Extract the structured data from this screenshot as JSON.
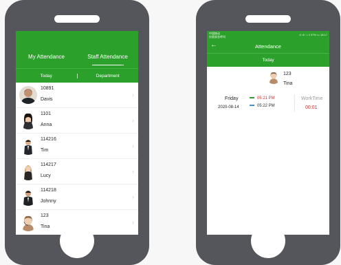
{
  "left_phone": {
    "tabs": [
      "My Attendance",
      "Staff Attendance"
    ],
    "active_tab": "Staff Attendance",
    "subtabs": [
      "Today",
      "Department"
    ],
    "staff": [
      {
        "id": "10891",
        "name": "Davis"
      },
      {
        "id": "1101",
        "name": "Anna"
      },
      {
        "id": "114216",
        "name": "Tim"
      },
      {
        "id": "114217",
        "name": "Lucy"
      },
      {
        "id": "114218",
        "name": "Johnny"
      },
      {
        "id": "123",
        "name": "Tina"
      }
    ],
    "chevron": "›"
  },
  "right_phone": {
    "status": {
      "carrier_line1": "中国移动",
      "carrier_line2": "仅限紧急呼叫",
      "indicators": "⊙ ⊘ ↑↓ ‖ 37% ▭ 18:17"
    },
    "back": "←",
    "title": "Attendance",
    "tab": "Today",
    "person": {
      "id": "123",
      "name": "Tina"
    },
    "day": "Friday",
    "date": "2020-08-14",
    "punch_in": "05:21 PM",
    "punch_out": "05:22 PM",
    "worktime_label": "WorkTime",
    "worktime_value": "00:01"
  },
  "colors": {
    "green": "#2ba02b",
    "phone_body": "#54565b",
    "alert_red": "#d12b2b",
    "blue": "#3e8ed0"
  }
}
